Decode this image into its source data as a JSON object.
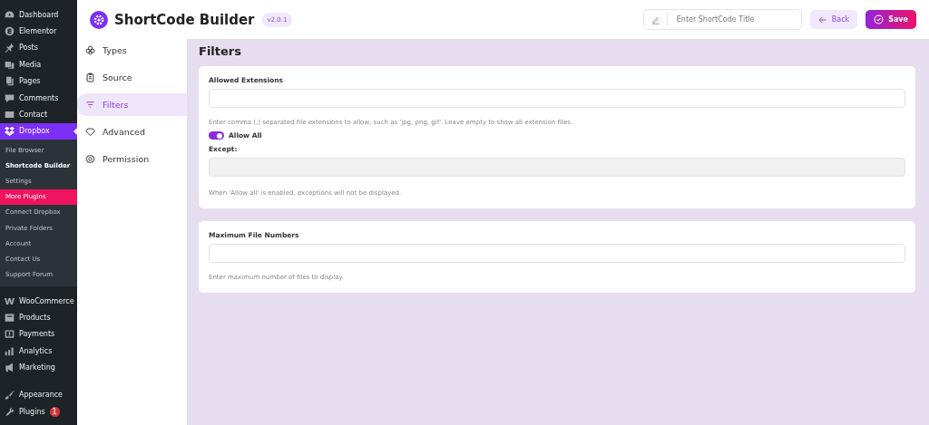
{
  "admin_menu": {
    "top_items": [
      {
        "label": "Dashboard",
        "selected": false
      },
      {
        "label": "Elementor",
        "selected": false
      },
      {
        "label": "Posts",
        "selected": false
      },
      {
        "label": "Media",
        "selected": false
      },
      {
        "label": "Pages",
        "selected": false
      },
      {
        "label": "Comments",
        "selected": false
      },
      {
        "label": "Contact",
        "selected": false
      },
      {
        "label": "Dropbox",
        "selected": true
      }
    ],
    "submenu": [
      {
        "label": "File Browser",
        "selected": false,
        "kind": "link"
      },
      {
        "label": "Shortcode Builder",
        "selected": true,
        "kind": "link"
      },
      {
        "label": "Settings",
        "selected": false,
        "kind": "link"
      },
      {
        "label": "More Plugins",
        "selected": false,
        "kind": "promo"
      },
      {
        "label": "Connect Dropbox",
        "selected": false,
        "kind": "link"
      },
      {
        "label": "Private Folders",
        "selected": false,
        "kind": "link"
      },
      {
        "label": "Account",
        "selected": false,
        "kind": "link"
      },
      {
        "label": "Contact Us",
        "selected": false,
        "kind": "link"
      },
      {
        "label": "Support Forum",
        "selected": false,
        "kind": "link"
      }
    ],
    "bottom_groups": [
      [
        {
          "label": "WooCommerce"
        },
        {
          "label": "Products"
        },
        {
          "label": "Payments"
        },
        {
          "label": "Analytics"
        },
        {
          "label": "Marketing"
        }
      ],
      [
        {
          "label": "Appearance"
        },
        {
          "label": "Plugins",
          "badge": "1"
        }
      ]
    ]
  },
  "header": {
    "title": "ShortCode Builder",
    "version": "v2.0.1",
    "title_field": {
      "placeholder": "Enter ShortCode Title"
    },
    "buttons": [
      {
        "label": "Back",
        "kind": "back"
      },
      {
        "label": "Save",
        "kind": "save"
      }
    ]
  },
  "tabs": [
    {
      "label": "Types",
      "selected": false
    },
    {
      "label": "Source",
      "selected": false
    },
    {
      "label": "Filters",
      "selected": true
    },
    {
      "label": "Advanced",
      "selected": false
    },
    {
      "label": "Permission",
      "selected": false
    }
  ],
  "page_title": "Filters",
  "cards": [
    {
      "label": "Allowed Extensions",
      "help": "Enter comma (,) separated file extensions to allow, such as 'jpg, png, gif'. Leave empty to show all extension files.",
      "toggle": {
        "label": "Allow All",
        "on": true
      },
      "except": {
        "label": "Except:",
        "disabled": true,
        "help": "When 'Allow all' is enabled, exceptions will not be displayed."
      }
    },
    {
      "label": "Maximum File Numbers",
      "help": "Enter maximum number of files to display."
    }
  ]
}
